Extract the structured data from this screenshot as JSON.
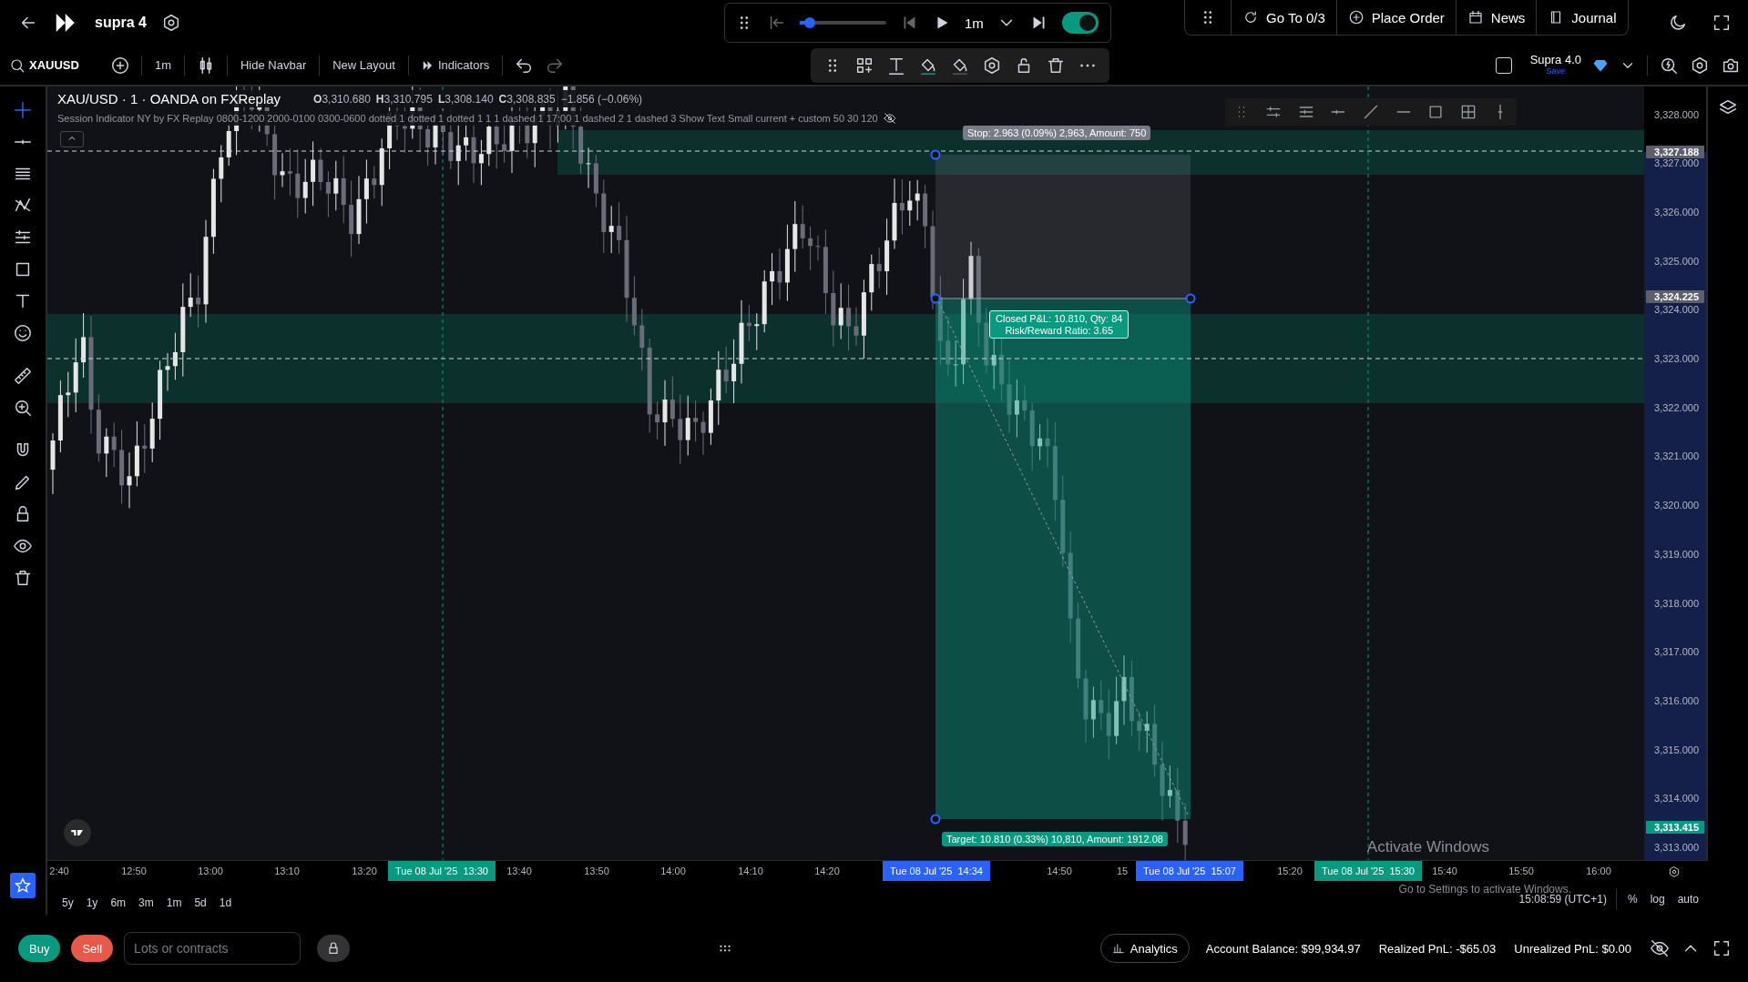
{
  "header": {
    "workspace": "supra 4"
  },
  "replay": {
    "progress": {
      "level": 0.12
    },
    "timeframe": "1m",
    "autoplay": {
      "on": true
    }
  },
  "nav_buttons": [
    {
      "label": "Go To 0/3",
      "kind": "goto"
    },
    {
      "label": "Place Order",
      "kind": "order"
    },
    {
      "label": "News",
      "kind": "news"
    },
    {
      "label": "Journal",
      "kind": "journal"
    }
  ],
  "toolbar": {
    "symbol": "XAUUSD",
    "interval": "1m",
    "buttons": [
      {
        "label": "Hide Navbar",
        "kind": "text"
      },
      {
        "label": "New Layout",
        "kind": "text"
      },
      {
        "label": "Indicators",
        "kind": "indicators"
      }
    ]
  },
  "template": {
    "name": "Supra 4.0",
    "action": "Save",
    "checked": false
  },
  "legend": {
    "title": "XAU/USD · 1 · OANDA on FXReplay",
    "ohlc": [
      {
        "key": "O",
        "value": "3,310.680"
      },
      {
        "key": "H",
        "value": "3,310.795"
      },
      {
        "key": "L",
        "value": "3,308.140"
      },
      {
        "key": "C",
        "value": "3,308.835"
      }
    ],
    "change": "−1.856 (−0.06%)",
    "indicator": "Session Indicator NY by FX Replay 0800-1200 2000-0100 0300-0600 dotted 1 dotted 1 dotted 1 1 1 dashed 1 17:00 1 dashed 2 1 dashed 3 Show Text Small current + custom 50 30 120"
  },
  "position": {
    "stop_label": "Stop: 2.963 (0.09%) 2,963, Amount: 750",
    "result_lines": [
      "Closed P&L: 10.810, Qty: 84",
      "Risk/Reward Ratio: 3.65"
    ],
    "target_label": "Target: 10.810 (0.33%) 10,810, Amount: 1912.08"
  },
  "price_axis": {
    "ticks": [
      "3,328.000",
      "3,327.000",
      "3,326.000",
      "3,325.000",
      "3,324.000",
      "3,323.000",
      "3,322.000",
      "3,321.000",
      "3,320.000",
      "3,319.000",
      "3,318.000",
      "3,317.000",
      "3,316.000",
      "3,315.000",
      "3,314.000",
      "3,313.000"
    ],
    "markers": [
      {
        "value": "3,327.188",
        "kind": "level"
      },
      {
        "value": "3,324.225",
        "kind": "level"
      },
      {
        "value": "3,313.415",
        "kind": "last"
      }
    ]
  },
  "time_axis": [
    {
      "text": "2:40",
      "kind": "tick"
    },
    {
      "text": "12:50",
      "kind": "tick"
    },
    {
      "text": "13:00",
      "kind": "tick"
    },
    {
      "text": "13:10",
      "kind": "tick"
    },
    {
      "text": "13:20",
      "kind": "tick"
    },
    {
      "text": "Tue 08 Jul '25  13:30",
      "kind": "session"
    },
    {
      "text": "13:40",
      "kind": "tick"
    },
    {
      "text": "13:50",
      "kind": "tick"
    },
    {
      "text": "14:00",
      "kind": "tick"
    },
    {
      "text": "14:10",
      "kind": "tick"
    },
    {
      "text": "14:20",
      "kind": "tick"
    },
    {
      "text": "Tue 08 Jul '25  14:34",
      "kind": "cursor"
    },
    {
      "text": "14:50",
      "kind": "tick"
    },
    {
      "text": "15",
      "kind": "tick"
    },
    {
      "text": "Tue 08 Jul '25  15:07",
      "kind": "cursor"
    },
    {
      "text": "15:20",
      "kind": "tick"
    },
    {
      "text": "Tue 08 Jul '25  15:30",
      "kind": "session"
    },
    {
      "text": "15:40",
      "kind": "tick"
    },
    {
      "text": "15:50",
      "kind": "tick"
    },
    {
      "text": "16:00",
      "kind": "tick"
    }
  ],
  "ranges": [
    "5y",
    "1y",
    "6m",
    "3m",
    "1m",
    "5d",
    "1d"
  ],
  "clock": "15:08:59 (UTC+1)",
  "scale_options": [
    "%",
    "log",
    "auto"
  ],
  "order": {
    "buy": "Buy",
    "sell": "Sell",
    "quantity_placeholder": "Lots or contracts"
  },
  "analytics": "Analytics",
  "account": [
    "Account Balance: $99,934.97",
    "Realized PnL: -$65.03",
    "Unrealized PnL: $0.00"
  ],
  "os_notice": {
    "title": "Activate Windows",
    "message": "Go to Settings to activate Windows."
  }
}
